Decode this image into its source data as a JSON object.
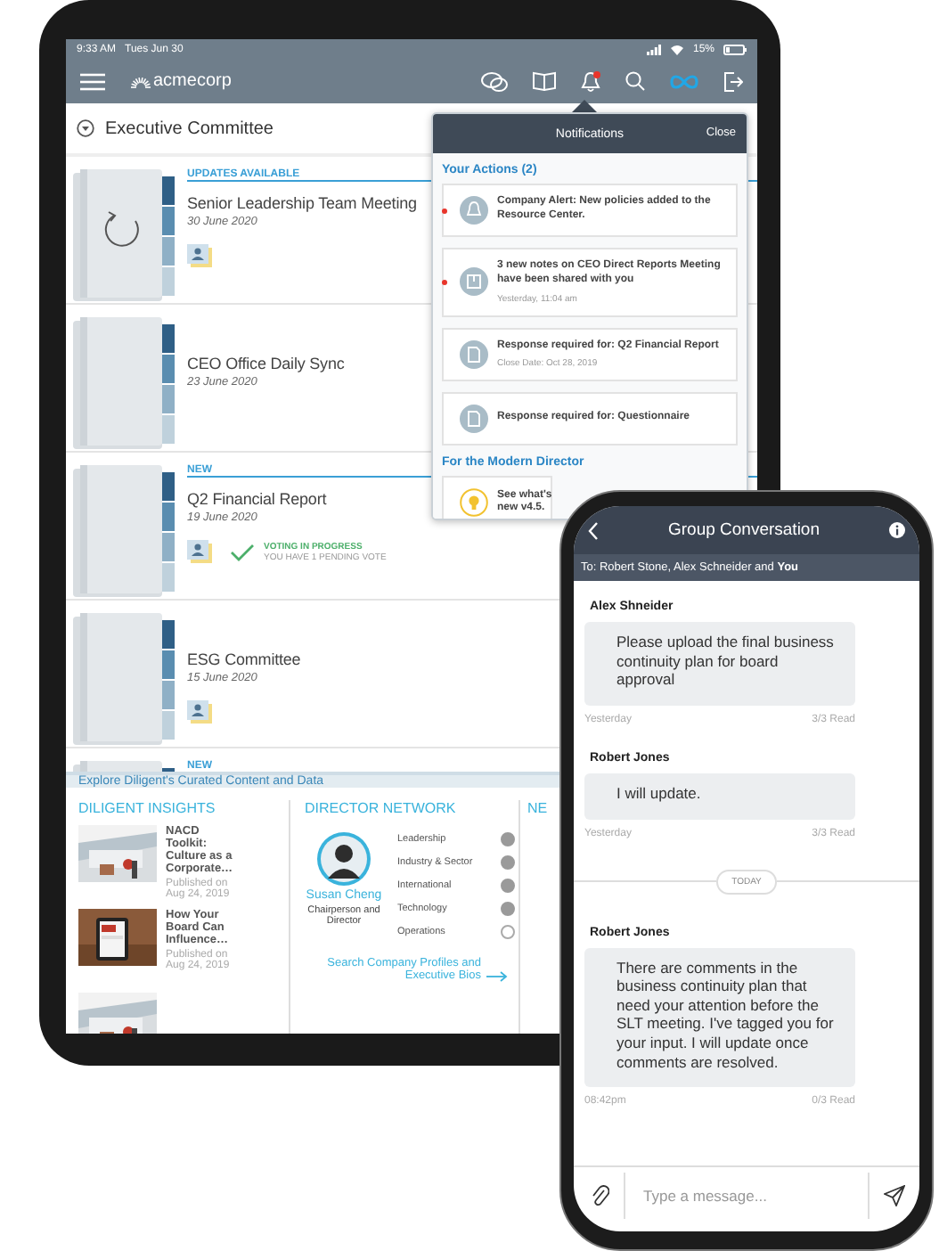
{
  "tablet": {
    "status_bar": {
      "time": "9:33 AM",
      "date": "Tues Jun 30",
      "battery": "15%"
    },
    "header": {
      "logo": "acmecorp",
      "bell_alert": true
    },
    "committee": {
      "title": "Executive Committee"
    },
    "meetings": [
      {
        "badge": "UPDATES AVAILABLE",
        "title": "Senior Leadership Team Meeting",
        "date": "30 June 2020",
        "syncing": true,
        "members": true
      },
      {
        "title": "CEO Office Daily Sync",
        "date": "23 June 2020",
        "syncing": false,
        "members": false
      },
      {
        "badge": "NEW",
        "title": "Q2 Financial Report",
        "date": "19 June 2020",
        "syncing": false,
        "members": true,
        "vote": {
          "status": "VOTING IN PROGRESS",
          "note": "YOU HAVE 1 PENDING VOTE"
        }
      },
      {
        "title": "ESG Committee",
        "date": "15 June 2020",
        "syncing": false,
        "members": true
      },
      {
        "badge": "NEW"
      }
    ],
    "notifications": {
      "title": "Notifications",
      "close": "Close",
      "sections": [
        {
          "heading": "Your Actions (2)",
          "items": [
            {
              "kind": "bell",
              "unread": true,
              "text": "Company Alert: New policies added to the Resource Center."
            },
            {
              "kind": "notes",
              "unread": true,
              "text": "3 new notes on CEO Direct Reports Meeting have been shared with you",
              "time": "Yesterday, 11:04 am"
            },
            {
              "kind": "document",
              "unread": false,
              "text": "Response required for: Q2 Financial Report",
              "time": "Close Date: Oct 28, 2019"
            },
            {
              "kind": "document",
              "unread": false,
              "text": "Response required for: Questionnaire"
            }
          ]
        },
        {
          "heading": "For the Modern Director",
          "items": [
            {
              "kind": "bulb",
              "unread": false,
              "text": "See what's new v4.5."
            }
          ]
        }
      ]
    },
    "explore": {
      "banner": "Explore Diligent's Curated Content and Data",
      "insights": {
        "heading": "DILIGENT INSIGHTS",
        "articles": [
          {
            "kind": "article",
            "title": "NACD Toolkit: Culture as a Corporate…",
            "published": "Published on Aug 24, 2019"
          },
          {
            "kind": "article",
            "title": "How Your Board Can Influence…",
            "published": "Published on Aug 24, 2019"
          },
          {
            "kind": "picture"
          }
        ]
      },
      "network": {
        "heading": "DIRECTOR NETWORK",
        "person": {
          "name": "Susan Cheng",
          "role": "Chairperson and Director"
        },
        "skills": [
          {
            "label": "Leadership",
            "checked": true
          },
          {
            "label": "Industry & Sector",
            "checked": true
          },
          {
            "label": "International",
            "checked": true
          },
          {
            "label": "Technology",
            "checked": true
          },
          {
            "label": "Operations",
            "checked": false
          }
        ],
        "link": "Search Company Profiles and Executive Bios"
      },
      "column_3": {
        "heading": "NE"
      }
    }
  },
  "phone": {
    "title": "Group Conversation",
    "recipients": "To: Robert Stone, Alex Schneider and **You**",
    "messages": [
      {
        "kind": "message",
        "sender": "Alex Shneider",
        "text": "Please upload the final business continuity plan for board approval",
        "time": "Yesterday",
        "read": "3/3 Read"
      },
      {
        "kind": "message",
        "sender": "Robert Jones",
        "text": "I will update.",
        "time": "Yesterday",
        "read": "3/3 Read"
      },
      {
        "kind": "divider",
        "label": "TODAY"
      },
      {
        "kind": "message",
        "sender": "Robert Jones",
        "text": "There are comments in the business continuity plan that need your attention before the SLT meeting. I've tagged you for your input. I will update once comments are resolved.",
        "time": "08:42pm",
        "read": "0/3 Read"
      }
    ],
    "composer": {
      "placeholder": "Type a message..."
    }
  }
}
